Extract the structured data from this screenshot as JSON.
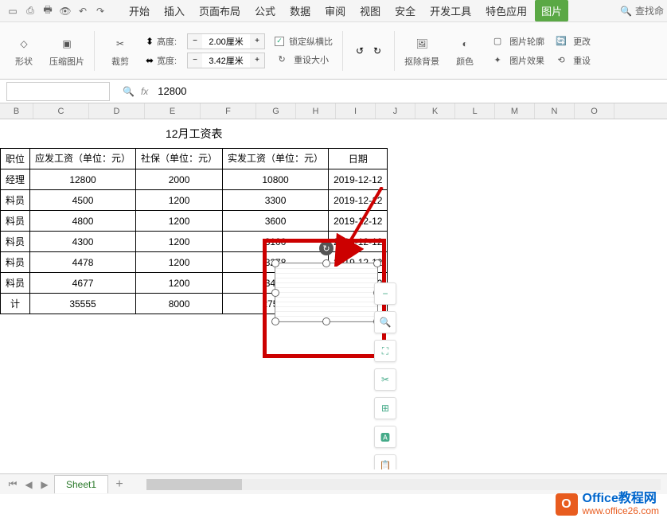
{
  "qat_icons": [
    "new",
    "open",
    "save",
    "print",
    "undo",
    "redo"
  ],
  "tabs": [
    "开始",
    "插入",
    "页面布局",
    "公式",
    "数据",
    "审阅",
    "视图",
    "安全",
    "开发工具",
    "特色应用",
    "图片"
  ],
  "active_tab_index": 10,
  "search_placeholder": "查找命",
  "ribbon": {
    "shape": "形状",
    "compress": "压缩图片",
    "crop": "裁剪",
    "height_label": "高度:",
    "height_value": "2.00厘米",
    "width_label": "宽度:",
    "width_value": "3.42厘米",
    "lock_ratio": "锁定纵横比",
    "reset_size": "重设大小",
    "remove_bg": "抠除背景",
    "color": "颜色",
    "outline": "图片轮廓",
    "effects": "图片效果",
    "change": "更改",
    "reset": "重设"
  },
  "formula": {
    "name_box": "",
    "value": "12800"
  },
  "columns": [
    "B",
    "C",
    "D",
    "E",
    "F",
    "G",
    "H",
    "I",
    "J",
    "K",
    "L",
    "M",
    "N",
    "O"
  ],
  "table": {
    "title": "12月工资表",
    "headers": [
      "职位",
      "应发工资（单位：元）",
      "社保（单位：元）",
      "实发工资（单位：元）",
      "日期"
    ],
    "rows": [
      [
        "经理",
        "12800",
        "2000",
        "10800",
        "2019-12-12"
      ],
      [
        "料员",
        "4500",
        "1200",
        "3300",
        "2019-12-12"
      ],
      [
        "料员",
        "4800",
        "1200",
        "3600",
        "2019-12-12"
      ],
      [
        "料员",
        "4300",
        "1200",
        "3100",
        "2019-12-12"
      ],
      [
        "料员",
        "4478",
        "1200",
        "3278",
        "2019-12-12"
      ],
      [
        "料员",
        "4677",
        "1200",
        "3477",
        "2019-12-12"
      ],
      [
        "计",
        "35555",
        "8000",
        "27555",
        ""
      ]
    ]
  },
  "sheet_tab": "Sheet1",
  "watermark": {
    "title": "Office教程网",
    "url": "www.office26.com"
  },
  "chart_data": {
    "type": "table",
    "title": "12月工资表",
    "columns": [
      "职位",
      "应发工资（单位：元）",
      "社保（单位：元）",
      "实发工资（单位：元）",
      "日期"
    ],
    "rows": [
      {
        "职位": "经理",
        "应发工资": 12800,
        "社保": 2000,
        "实发工资": 10800,
        "日期": "2019-12-12"
      },
      {
        "职位": "料员",
        "应发工资": 4500,
        "社保": 1200,
        "实发工资": 3300,
        "日期": "2019-12-12"
      },
      {
        "职位": "料员",
        "应发工资": 4800,
        "社保": 1200,
        "实发工资": 3600,
        "日期": "2019-12-12"
      },
      {
        "职位": "料员",
        "应发工资": 4300,
        "社保": 1200,
        "实发工资": 3100,
        "日期": "2019-12-12"
      },
      {
        "职位": "料员",
        "应发工资": 4478,
        "社保": 1200,
        "实发工资": 3278,
        "日期": "2019-12-12"
      },
      {
        "职位": "料员",
        "应发工资": 4677,
        "社保": 1200,
        "实发工资": 3477,
        "日期": "2019-12-12"
      },
      {
        "职位": "计",
        "应发工资": 35555,
        "社保": 8000,
        "实发工资": 27555,
        "日期": ""
      }
    ]
  }
}
